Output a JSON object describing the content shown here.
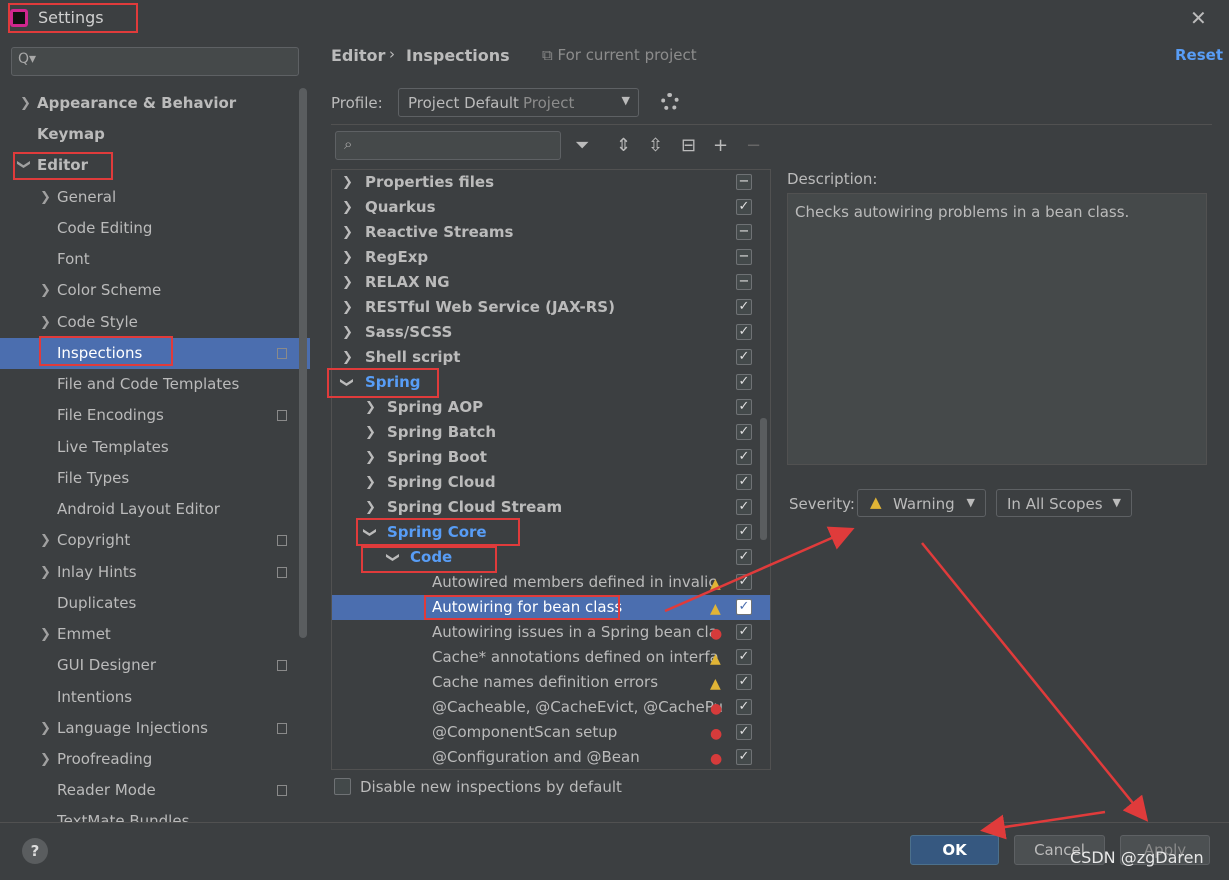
{
  "window": {
    "title": "Settings",
    "close": "✕"
  },
  "sidebar": {
    "search_placeholder": "Q▾",
    "items": [
      {
        "label": "Appearance & Behavior"
      },
      {
        "label": "Keymap"
      },
      {
        "label": "Editor"
      },
      {
        "label": "General"
      },
      {
        "label": "Code Editing"
      },
      {
        "label": "Font"
      },
      {
        "label": "Color Scheme"
      },
      {
        "label": "Code Style"
      },
      {
        "label": "Inspections"
      },
      {
        "label": "File and Code Templates"
      },
      {
        "label": "File Encodings"
      },
      {
        "label": "Live Templates"
      },
      {
        "label": "File Types"
      },
      {
        "label": "Android Layout Editor"
      },
      {
        "label": "Copyright"
      },
      {
        "label": "Inlay Hints"
      },
      {
        "label": "Duplicates"
      },
      {
        "label": "Emmet"
      },
      {
        "label": "GUI Designer"
      },
      {
        "label": "Intentions"
      },
      {
        "label": "Language Injections"
      },
      {
        "label": "Proofreading"
      },
      {
        "label": "Reader Mode"
      },
      {
        "label": "TextMate Bundles"
      }
    ]
  },
  "breadcrumb": {
    "first": "Editor",
    "sep": "›",
    "second": "Inspections",
    "scope": "For current project"
  },
  "reset_label": "Reset",
  "profile": {
    "label": "Profile:",
    "value": "Project Default",
    "kind": "Project"
  },
  "tree": {
    "rows": [
      {
        "label": "Properties files"
      },
      {
        "label": "Quarkus"
      },
      {
        "label": "Reactive Streams"
      },
      {
        "label": "RegExp"
      },
      {
        "label": "RELAX NG"
      },
      {
        "label": "RESTful Web Service (JAX-RS)"
      },
      {
        "label": "Sass/SCSS"
      },
      {
        "label": "Shell script"
      },
      {
        "label": "Spring"
      },
      {
        "label": "Spring AOP"
      },
      {
        "label": "Spring Batch"
      },
      {
        "label": "Spring Boot"
      },
      {
        "label": "Spring Cloud"
      },
      {
        "label": "Spring Cloud Stream"
      },
      {
        "label": "Spring Core"
      },
      {
        "label": "Code"
      },
      {
        "label": "Autowired members defined in invalic"
      },
      {
        "label": "Autowiring for bean class"
      },
      {
        "label": "Autowiring issues in a Spring bean cla"
      },
      {
        "label": "Cache* annotations defined on interfa"
      },
      {
        "label": "Cache names definition errors"
      },
      {
        "label": "@Cacheable, @CacheEvict, @CachePu"
      },
      {
        "label": "@ComponentScan setup"
      },
      {
        "label": "@Configuration and @Bean"
      }
    ]
  },
  "description": {
    "label": "Description:",
    "text": "Checks autowiring problems in a bean class."
  },
  "severity": {
    "label": "Severity:",
    "value": "Warning",
    "scope": "In All Scopes"
  },
  "disable_new": "Disable new inspections by default",
  "buttons": {
    "ok": "OK",
    "cancel": "Cancel",
    "apply": "Apply",
    "help": "?"
  },
  "watermark": "CSDN @zgDaren",
  "colors": {
    "accent": "#4b6eaf",
    "link": "#589df6",
    "warning": "#e0b436",
    "error": "#d63b3b",
    "annotation": "#e03b3b"
  }
}
